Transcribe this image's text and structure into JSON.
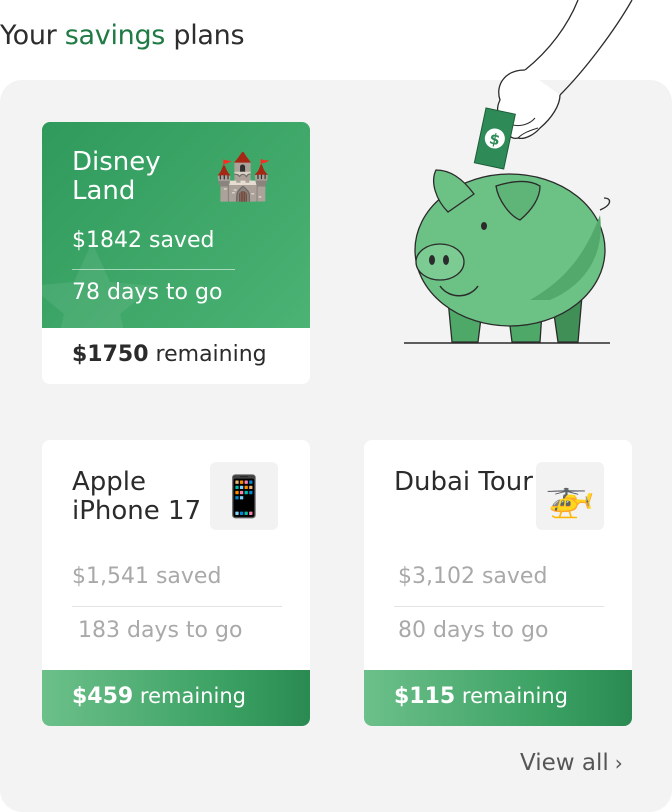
{
  "header": {
    "prefix": "Your",
    "accent": "savings",
    "suffix": "plans"
  },
  "featured": {
    "title": "Disney Land",
    "icon": "castle-icon",
    "emoji": "🏰",
    "saved": "$1842 saved",
    "days": "78 days to go",
    "remaining_amount": "$1750",
    "remaining_label": "remaining"
  },
  "plans": [
    {
      "title": "Apple iPhone 17",
      "icon": "mobile-phone-icon",
      "emoji": "📱",
      "saved": "$1,541 saved",
      "days": "183 days to go",
      "remaining_amount": "$459",
      "remaining_label": "remaining"
    },
    {
      "title": "Dubai Tour",
      "icon": "helicopter-icon",
      "emoji": "🚁",
      "saved": "$3,102 saved",
      "days": "80 days to go",
      "remaining_amount": "$115",
      "remaining_label": "remaining"
    }
  ],
  "footer": {
    "view_all": "View all",
    "chevron": "›"
  },
  "illustration": {
    "icon": "piggy-bank-icon",
    "bill_symbol": "$"
  },
  "colors": {
    "accent": "#1f7a44",
    "card_green": "#3aa062",
    "panel_bg": "#f3f3f3"
  }
}
